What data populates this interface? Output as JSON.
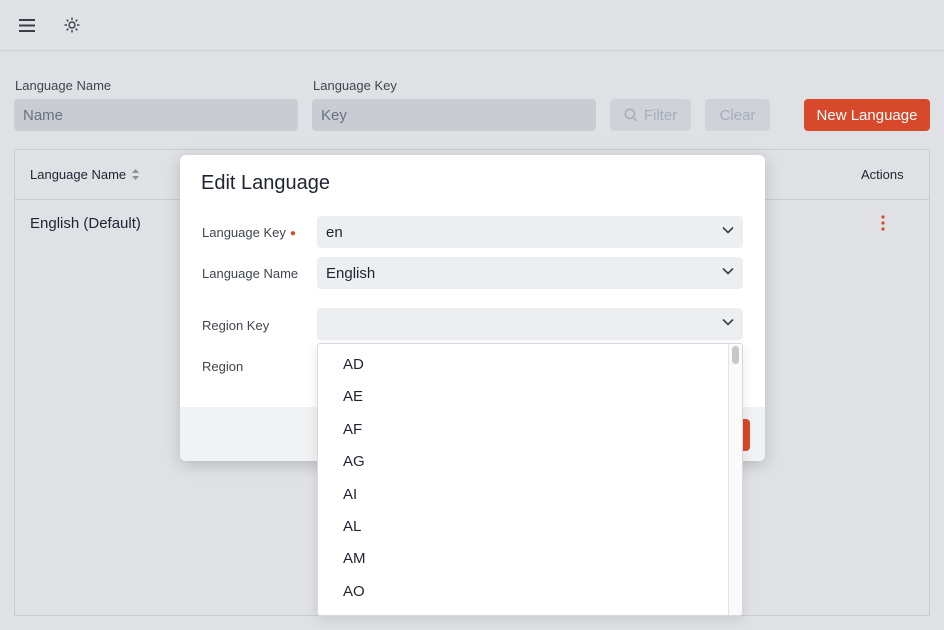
{
  "topbar": {
    "menu_icon": "hamburger-menu-icon",
    "theme_icon": "sun-icon"
  },
  "filters": {
    "name_label": "Language Name",
    "name_placeholder": "Name",
    "key_label": "Language Key",
    "key_placeholder": "Key",
    "filter_label": "Filter",
    "clear_label": "Clear",
    "new_label": "New Language"
  },
  "table": {
    "col_name": "Language Name",
    "col_actions": "Actions",
    "rows": [
      {
        "name": "English (Default)"
      }
    ]
  },
  "modal": {
    "title": "Edit Language",
    "key_label": "Language Key",
    "key_value": "en",
    "name_label": "Language Name",
    "name_value": "English",
    "region_key_label": "Region Key",
    "region_key_value": "",
    "region_label": "Region"
  },
  "dropdown": {
    "options": [
      "AD",
      "AE",
      "AF",
      "AG",
      "AI",
      "AL",
      "AM",
      "AO"
    ]
  },
  "colors": {
    "accent": "#d8482a",
    "background": "#dfe1e5",
    "input": "#c9ccd3"
  }
}
